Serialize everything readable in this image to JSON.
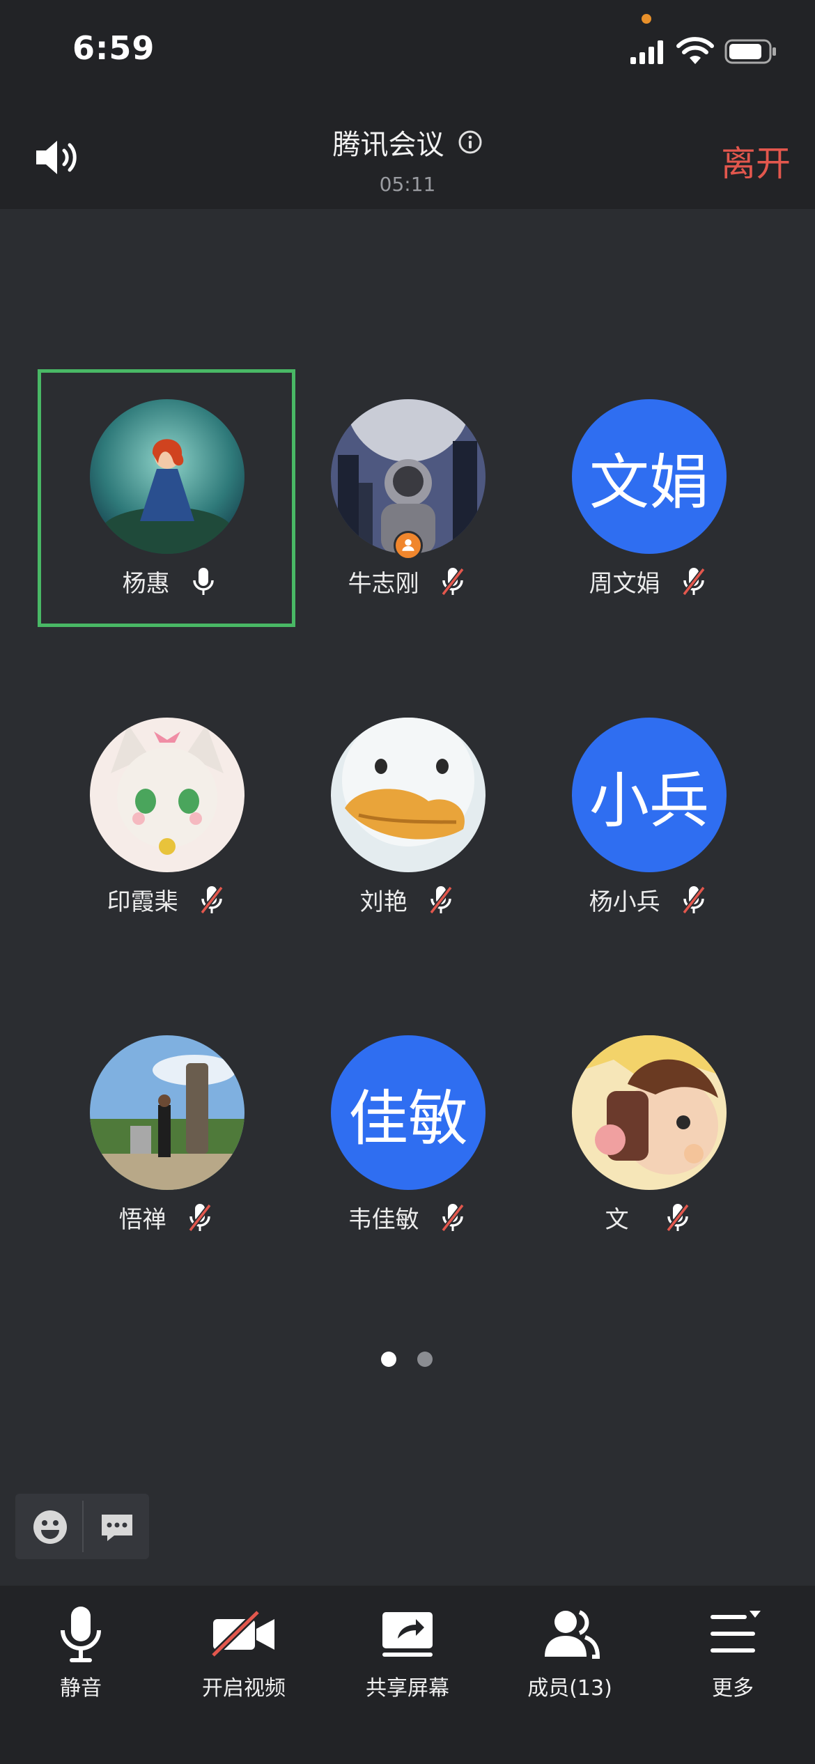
{
  "status": {
    "time": "6:59"
  },
  "header": {
    "title": "腾讯会议",
    "duration": "05:11",
    "leave_label": "离开"
  },
  "participants": [
    {
      "name": "杨惠",
      "avatar_icon": "cartoon-princess-avatar",
      "muted": false,
      "active_speaker": true
    },
    {
      "name": "牛志刚",
      "avatar_icon": "astronaut-city-avatar",
      "muted": true,
      "host": true
    },
    {
      "name": "周文娟",
      "avatar_text": "文娟",
      "muted": true
    },
    {
      "name": "印霞棐",
      "avatar_icon": "anime-catgirl-avatar",
      "muted": true
    },
    {
      "name": "刘艳",
      "avatar_icon": "duck-cartoon-avatar",
      "muted": true
    },
    {
      "name": "杨小兵",
      "avatar_text": "小兵",
      "muted": true
    },
    {
      "name": "悟禅",
      "avatar_icon": "landscape-photo-avatar",
      "muted": true
    },
    {
      "name": "韦佳敏",
      "avatar_text": "佳敏",
      "muted": true
    },
    {
      "name": "文",
      "avatar_icon": "anime-boy-avatar",
      "muted": true
    }
  ],
  "pagination": {
    "current": 1,
    "total": 2
  },
  "toolbar": {
    "mute_label": "静音",
    "video_label": "开启视频",
    "share_label": "共享屏幕",
    "members_label": "成员(13)",
    "more_label": "更多"
  },
  "colors": {
    "accent_blue": "#2f6ef1",
    "leave_red": "#e3574d",
    "speaker_green": "#49b865",
    "host_orange": "#f0862d"
  }
}
